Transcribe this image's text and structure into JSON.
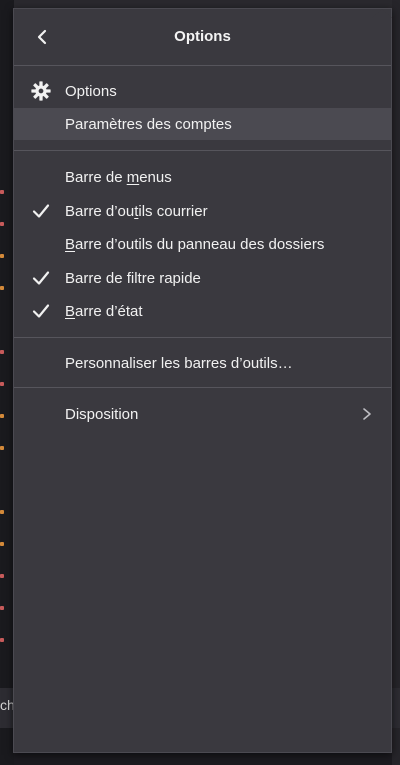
{
  "header": {
    "title": "Options"
  },
  "menu": {
    "options": "Options",
    "account_settings": "Paramètres des comptes",
    "menubar": {
      "pre": "Barre de ",
      "ul": "m",
      "post": "enus"
    },
    "mail_toolbar": {
      "pre": "Barre d’ou",
      "ul": "t",
      "post": "ils courrier"
    },
    "folder_pane_toolbar": {
      "pre": "",
      "ul": "B",
      "post": "arre d’outils du panneau des dossiers"
    },
    "quick_filter_bar": "Barre de filtre rapide",
    "status_bar": {
      "pre": "",
      "ul": "B",
      "post": "arre d’état"
    },
    "customize_toolbars": "Personnaliser les barres d’outils…",
    "layout": "Disposition"
  },
  "checked": {
    "menubar": false,
    "mail_toolbar": true,
    "folder_pane_toolbar": false,
    "quick_filter_bar": true,
    "status_bar": true
  },
  "background": {
    "bottom_fragment": "ch"
  },
  "colors": {
    "panel": "#3a393f",
    "hover": "#4b4a51",
    "text": "#f1f1f1",
    "separator": "#56555c"
  }
}
